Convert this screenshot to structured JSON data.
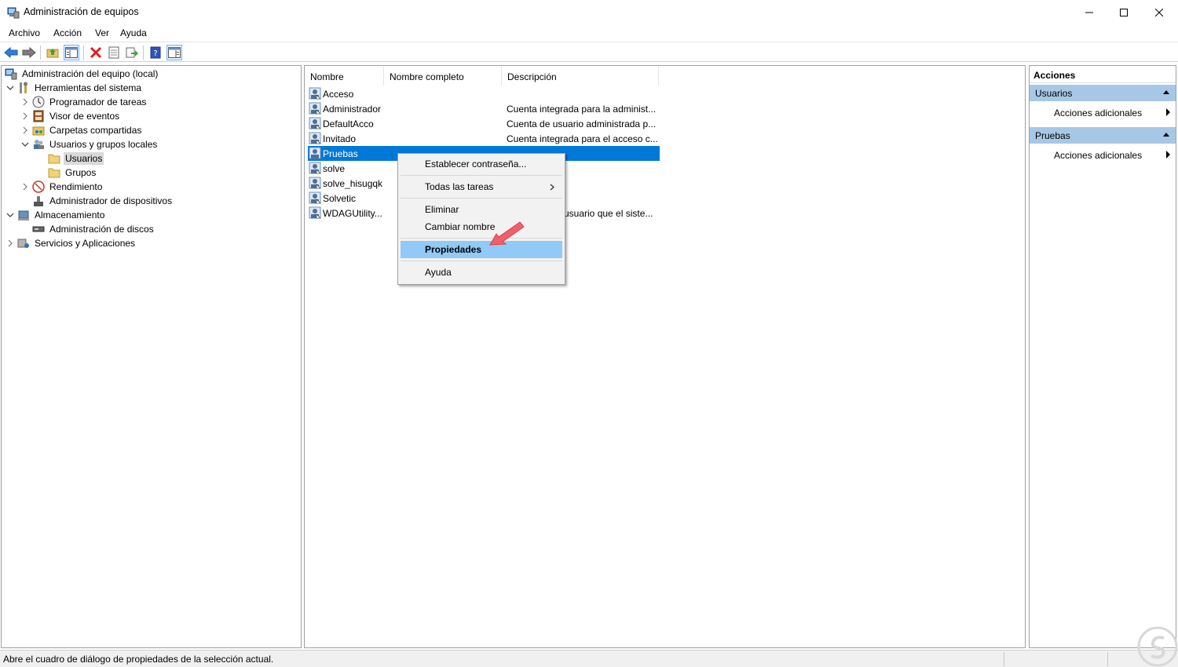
{
  "window": {
    "title": "Administración de equipos",
    "icon": "computer-management-icon"
  },
  "menubar": [
    "Archivo",
    "Acción",
    "Ver",
    "Ayuda"
  ],
  "toolbar": {
    "icons": [
      "back-arrow-icon",
      "forward-arrow-icon",
      "up-folder-icon",
      "show-hide-tree-icon",
      "delete-icon",
      "properties-icon",
      "export-list-icon",
      "help-icon",
      "show-hide-action-pane-icon"
    ]
  },
  "tree": {
    "root": "Administración del equipo (local)",
    "system_tools": "Herramientas del sistema",
    "task_scheduler": "Programador de tareas",
    "event_viewer": "Visor de eventos",
    "shared_folders": "Carpetas compartidas",
    "local_users_groups": "Usuarios y grupos locales",
    "users": "Usuarios",
    "groups": "Grupos",
    "performance": "Rendimiento",
    "device_manager": "Administrador de dispositivos",
    "storage": "Almacenamiento",
    "disk_management": "Administración de discos",
    "services_apps": "Servicios y Aplicaciones"
  },
  "list": {
    "columns": [
      "Nombre",
      "Nombre completo",
      "Descripción"
    ],
    "rows": [
      {
        "name": "Acceso",
        "full_name": "",
        "description": ""
      },
      {
        "name": "Administrador",
        "full_name": "",
        "description": "Cuenta integrada para la administ..."
      },
      {
        "name": "DefaultAcco",
        "full_name": "",
        "description": "Cuenta de usuario administrada p..."
      },
      {
        "name": "Invitado",
        "full_name": "",
        "description": "Cuenta integrada para el acceso c..."
      },
      {
        "name": "Pruebas",
        "full_name": "",
        "description": ""
      },
      {
        "name": "solve",
        "full_name": "",
        "description": ""
      },
      {
        "name": "solve_hisugqk",
        "full_name": "",
        "description": ""
      },
      {
        "name": "Solvetic",
        "full_name": "",
        "description": ""
      },
      {
        "name": "WDAGUtility...",
        "full_name": "",
        "description": "usuario que el siste..."
      }
    ],
    "selected_row": "Pruebas"
  },
  "context_menu": {
    "items": [
      "Establecer contraseña...",
      "Todas las tareas",
      "Eliminar",
      "Cambiar nombre",
      "Propiedades",
      "Ayuda"
    ],
    "highlighted": "Propiedades"
  },
  "actions": {
    "header": "Acciones",
    "group1": "Usuarios",
    "group1_action": "Acciones adicionales",
    "group2": "Pruebas",
    "group2_action": "Acciones adicionales"
  },
  "statusbar": {
    "text": "Abre el cuadro de diálogo de propiedades de la selección actual."
  },
  "colors": {
    "selection": "#0078d7",
    "menu_highlight": "#91c9f7",
    "action_group": "#a6c8e6",
    "annotation_arrow": "#f0606a"
  }
}
